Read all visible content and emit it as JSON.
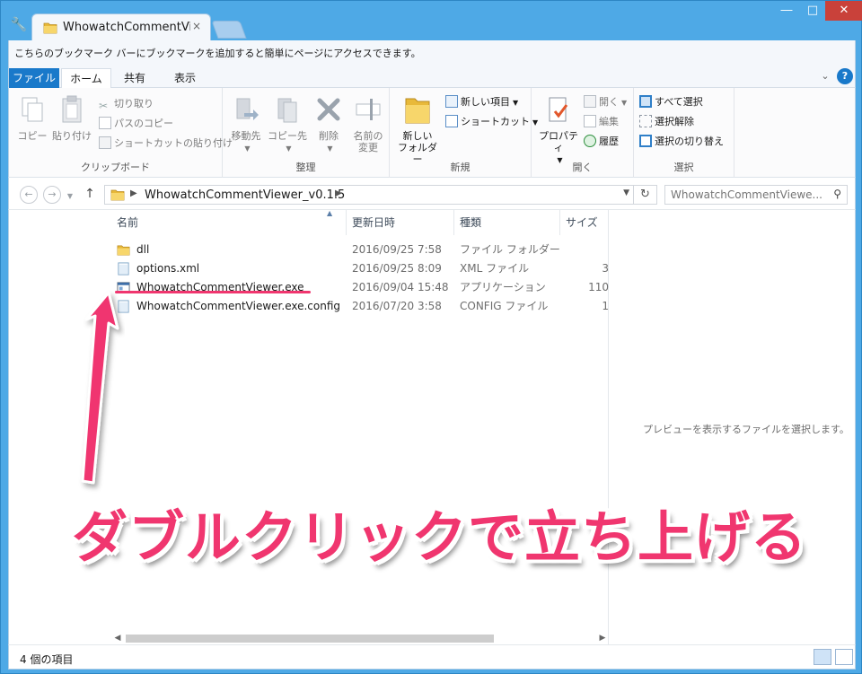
{
  "browser": {
    "tab_title": "WhowatchCommentViewer",
    "bookmark_prompt": "こちらのブックマーク バーにブックマークを追加すると簡単にページにアクセスできます。",
    "window_controls": {
      "minimize": "―",
      "maximize": "□",
      "close": "✕"
    },
    "tab_close": "×"
  },
  "ribbon_tabs": [
    {
      "label": "ファイル"
    },
    {
      "label": "ホーム"
    },
    {
      "label": "共有"
    },
    {
      "label": "表示"
    }
  ],
  "ribbon": {
    "clipboard": {
      "label": "クリップボード",
      "copy": "コピー",
      "paste": "貼り付け",
      "cut": "切り取り",
      "copy_path": "パスのコピー",
      "paste_shortcut": "ショートカットの貼り付け"
    },
    "organize": {
      "label": "整理",
      "move_to": "移動先",
      "copy_to": "コピー先",
      "delete": "削除",
      "rename_line1": "名前の",
      "rename_line2": "変更"
    },
    "new": {
      "label": "新規",
      "new_folder_line1": "新しい",
      "new_folder_line2": "フォルダー",
      "new_item": "新しい項目",
      "shortcut": "ショートカット"
    },
    "open": {
      "label": "開く",
      "properties": "プロパティ",
      "open": "開く",
      "edit": "編集",
      "history": "履歴"
    },
    "select": {
      "label": "選択",
      "select_all": "すべて選択",
      "select_none": "選択解除",
      "invert": "選択の切り替え"
    }
  },
  "address": {
    "path": "WhowatchCommentViewer_v0.1.5",
    "search_placeholder": "WhowatchCommentViewe..."
  },
  "columns": {
    "name": "名前",
    "date": "更新日時",
    "type": "種類",
    "size": "サイズ"
  },
  "files": [
    {
      "name": "dll",
      "date": "2016/09/25 7:58",
      "type": "ファイル フォルダー",
      "size": "",
      "icon": "folder-icon"
    },
    {
      "name": "options.xml",
      "date": "2016/09/25 8:09",
      "type": "XML ファイル",
      "size": "3",
      "icon": "xml-file-icon"
    },
    {
      "name": "WhowatchCommentViewer.exe",
      "date": "2016/09/04 15:48",
      "type": "アプリケーション",
      "size": "110",
      "icon": "exe-app-icon"
    },
    {
      "name": "WhowatchCommentViewer.exe.config",
      "date": "2016/07/20 3:58",
      "type": "CONFIG ファイル",
      "size": "1",
      "icon": "config-file-icon"
    }
  ],
  "preview_message": "プレビューを表示するファイルを選択します。",
  "status": {
    "item_count": "4 個の項目"
  },
  "annotation": {
    "caption": "ダブルクリックで立ち上げる",
    "color": "#f0366f"
  },
  "colors": {
    "ribbon_file_tab": "#1979ca",
    "window_frame": "#4ea9e6",
    "annotation": "#f0366f"
  }
}
